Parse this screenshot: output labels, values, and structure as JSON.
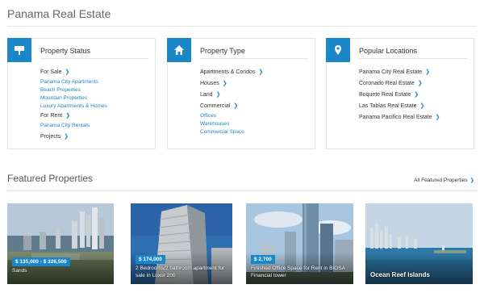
{
  "page_title": "Panama Real Estate",
  "colors": {
    "accent": "#1a87c9",
    "border": "#e4e4e4"
  },
  "cards": [
    {
      "title": "Property Status",
      "icon": "sign-icon",
      "groups": [
        {
          "label": "For Sale",
          "subs": [
            "Panama City Apartments",
            "Beach Properties",
            "Mountain Properties",
            "Luxury Apartments & Homes"
          ]
        },
        {
          "label": "For Rent",
          "subs": [
            "Panama City Rentals"
          ]
        },
        {
          "label": "Projects",
          "subs": []
        }
      ]
    },
    {
      "title": "Property Type",
      "icon": "home-icon",
      "groups": [
        {
          "label": "Apartments & Condos",
          "subs": []
        },
        {
          "label": "Houses",
          "subs": []
        },
        {
          "label": "Land",
          "subs": []
        },
        {
          "label": "Commercial",
          "subs": [
            "Offices",
            "Warehouses",
            "Commercial Space"
          ]
        }
      ]
    },
    {
      "title": "Popular Locations",
      "icon": "map-pin-icon",
      "groups": [
        {
          "label": "Panama City Real Estate",
          "subs": []
        },
        {
          "label": "Coronado Real Estate",
          "subs": []
        },
        {
          "label": "Boquete Real Estate",
          "subs": []
        },
        {
          "label": "Las Tablas Real Estate",
          "subs": []
        },
        {
          "label": "Panama Pacifico Real Estate",
          "subs": []
        }
      ]
    }
  ],
  "featured": {
    "title": "Featured Properties",
    "all_link": "All Featured Properties",
    "items": [
      {
        "price": "$ 135,000 - $ 326,500",
        "caption": "Sands",
        "photo": "city-skyline-aerial"
      },
      {
        "price": "$ 174,000",
        "caption": "2 Bedrooms/2 bathroom apartment for sale in Luxor 200",
        "photo": "high-rise-tower"
      },
      {
        "price": "$ 2,700",
        "caption": "Finished Office Space for Rent in BIOSA Financial tower",
        "photo": "glass-office-towers"
      },
      {
        "price": "",
        "caption": "Ocean Reef Islands",
        "photo": "waterfront-skyline"
      }
    ]
  }
}
